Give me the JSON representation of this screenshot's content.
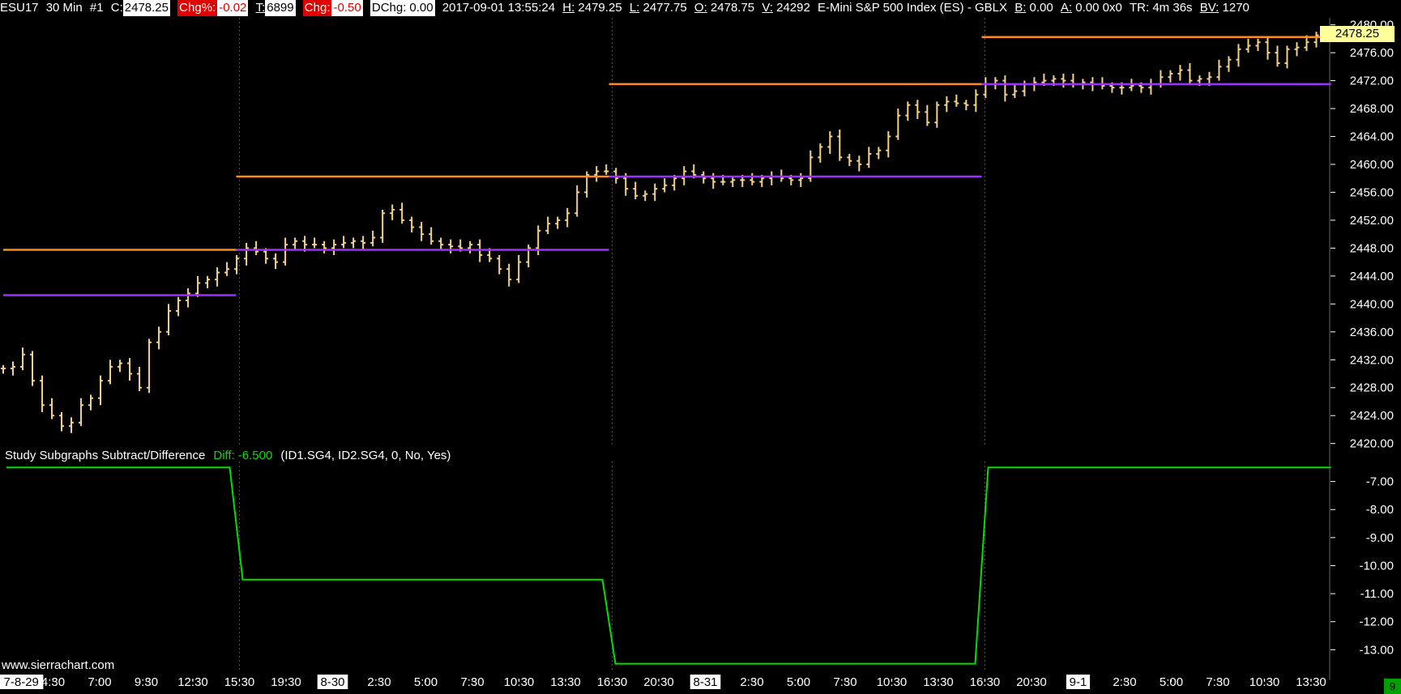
{
  "header": {
    "symbol": "ESU17",
    "timeframe": "30 Min",
    "chart_num": "#1",
    "close_label": "C:",
    "close_value": "2478.25",
    "chgpct_label": "Chg%:",
    "chgpct_value": "-0.02",
    "ticks_label": "T:",
    "ticks_value": "6899",
    "chg_label": "Chg:",
    "chg_value": "-0.50",
    "dchg_label": "DChg:",
    "dchg_value": "0.00",
    "datetime": "2017-09-01 13:55:24",
    "high_label": "H:",
    "high_value": "2479.25",
    "low_label": "L:",
    "low_value": "2477.75",
    "open_label": "O:",
    "open_value": "2478.75",
    "volume_label": "V:",
    "volume_value": "24292",
    "instrument": "E-Mini S&P 500 Index (ES) - GBLX",
    "bid_label": "B:",
    "bid_value": "0.00",
    "ask_label": "A:",
    "ask_value": "0.00 0x0",
    "tr_label": "TR:",
    "tr_value": "4m 36s",
    "bv_label": "BV:",
    "bv_value": "1270"
  },
  "study": {
    "name": "Study Subgraphs Subtract/Difference",
    "diff_label": "Diff:",
    "diff_value": "-6.500",
    "params": "(ID1.SG4, ID2.SG4, 0, No, Yes)"
  },
  "watermark": "www.sierrachart.com",
  "price_box": "2478.25",
  "corner_label": "9",
  "colors": {
    "bar": "#f4d28a",
    "orange_line": "#ff8c1a",
    "purple_line": "#9b30ff",
    "diff_line": "#00e000",
    "axis_text": "#ffffff",
    "grid_separator": "#505050"
  },
  "chart_data": [
    {
      "type": "ohlc_bar",
      "name": "ESU17 30 Min",
      "y_axis_ticks": [
        2420.0,
        2424.0,
        2428.0,
        2432.0,
        2436.0,
        2440.0,
        2444.0,
        2448.0,
        2452.0,
        2456.0,
        2460.0,
        2464.0,
        2468.0,
        2472.0,
        2476.0,
        2480.0
      ],
      "ylim": [
        2419.5,
        2481.0
      ],
      "x_tick_labels": [
        "7-8-29",
        "4:30",
        "7:00",
        "9:30",
        "12:30",
        "15:30",
        "19:30",
        "8-30",
        "2:30",
        "5:00",
        "7:30",
        "10:30",
        "13:30",
        "16:30",
        "20:30",
        "8-31",
        "2:30",
        "5:00",
        "7:30",
        "10:30",
        "13:30",
        "16:30",
        "20:30",
        "9-1",
        "2:30",
        "5:00",
        "7:30",
        "10:30",
        "13:30"
      ],
      "x_tick_boxed": [
        true,
        false,
        false,
        false,
        false,
        false,
        false,
        true,
        false,
        false,
        false,
        false,
        false,
        false,
        false,
        true,
        false,
        false,
        false,
        false,
        false,
        false,
        false,
        true,
        false,
        false,
        false,
        false,
        false
      ],
      "session_separator_indices": [
        5,
        13,
        21
      ],
      "close_path": [
        2430.75,
        2431.0,
        2432.75,
        2429.0,
        2425.5,
        2424.0,
        2422.5,
        2423.0,
        2425.5,
        2426.5,
        2429.0,
        2431.0,
        2431.5,
        2430.0,
        2428.0,
        2434.5,
        2436.0,
        2439.0,
        2440.5,
        2441.5,
        2443.0,
        2443.5,
        2444.5,
        2445.0,
        2446.5,
        2448.0,
        2447.5,
        2446.5,
        2446.0,
        2448.5,
        2449.0,
        2448.5,
        2448.5,
        2448.0,
        2448.5,
        2448.75,
        2449.0,
        2448.75,
        2449.5,
        2453.0,
        2453.5,
        2452.0,
        2451.0,
        2450.0,
        2449.0,
        2448.5,
        2448.25,
        2448.0,
        2448.5,
        2447.0,
        2446.5,
        2445.0,
        2443.5,
        2446.0,
        2448.0,
        2450.5,
        2451.5,
        2452.0,
        2453.0,
        2456.0,
        2458.5,
        2459.0,
        2459.0,
        2458.0,
        2456.5,
        2455.5,
        2455.75,
        2456.5,
        2457.0,
        2458.0,
        2459.0,
        2458.5,
        2458.0,
        2457.5,
        2457.5,
        2457.75,
        2457.75,
        2457.5,
        2458.0,
        2458.25,
        2458.0,
        2457.75,
        2458.0,
        2461.0,
        2462.5,
        2464.0,
        2461.0,
        2460.5,
        2460.0,
        2461.5,
        2462.0,
        2464.0,
        2467.0,
        2468.5,
        2467.5,
        2466.0,
        2468.5,
        2469.0,
        2468.75,
        2468.5,
        2470.0,
        2471.5,
        2472.0,
        2470.0,
        2470.5,
        2471.5,
        2471.75,
        2472.0,
        2472.25,
        2472.0,
        2471.5,
        2471.75,
        2471.5,
        2471.25,
        2471.0,
        2471.0,
        2471.25,
        2471.0,
        2471.5,
        2472.5,
        2473.0,
        2473.5,
        2472.0,
        2472.25,
        2472.5,
        2474.0,
        2475.0,
        2476.5,
        2477.0,
        2477.5,
        2476.0,
        2474.5,
        2476.5,
        2476.75,
        2477.5,
        2478.5,
        2478.75,
        2478.25
      ],
      "lines": [
        {
          "role": "orange",
          "segments": [
            [
              0,
              5,
              2447.75
            ],
            [
              5,
              13,
              2458.25
            ],
            [
              13,
              21,
              2471.5
            ],
            [
              21,
              28.5,
              2478.25
            ]
          ]
        },
        {
          "role": "purple",
          "segments": [
            [
              0,
              5,
              2441.25
            ],
            [
              5,
              13,
              2447.75
            ],
            [
              13,
              21,
              2458.25
            ],
            [
              21,
              28.5,
              2471.5
            ]
          ]
        }
      ]
    },
    {
      "type": "line",
      "name": "Diff",
      "y_axis_ticks": [
        -7.0,
        -8.0,
        -9.0,
        -10.0,
        -11.0,
        -12.0,
        -13.0
      ],
      "ylim": [
        -13.8,
        -6.0
      ],
      "segments": [
        [
          0,
          5,
          -6.5
        ],
        [
          5,
          13,
          -10.5
        ],
        [
          13,
          21,
          -13.5
        ],
        [
          21,
          28.5,
          -6.5
        ]
      ]
    }
  ]
}
